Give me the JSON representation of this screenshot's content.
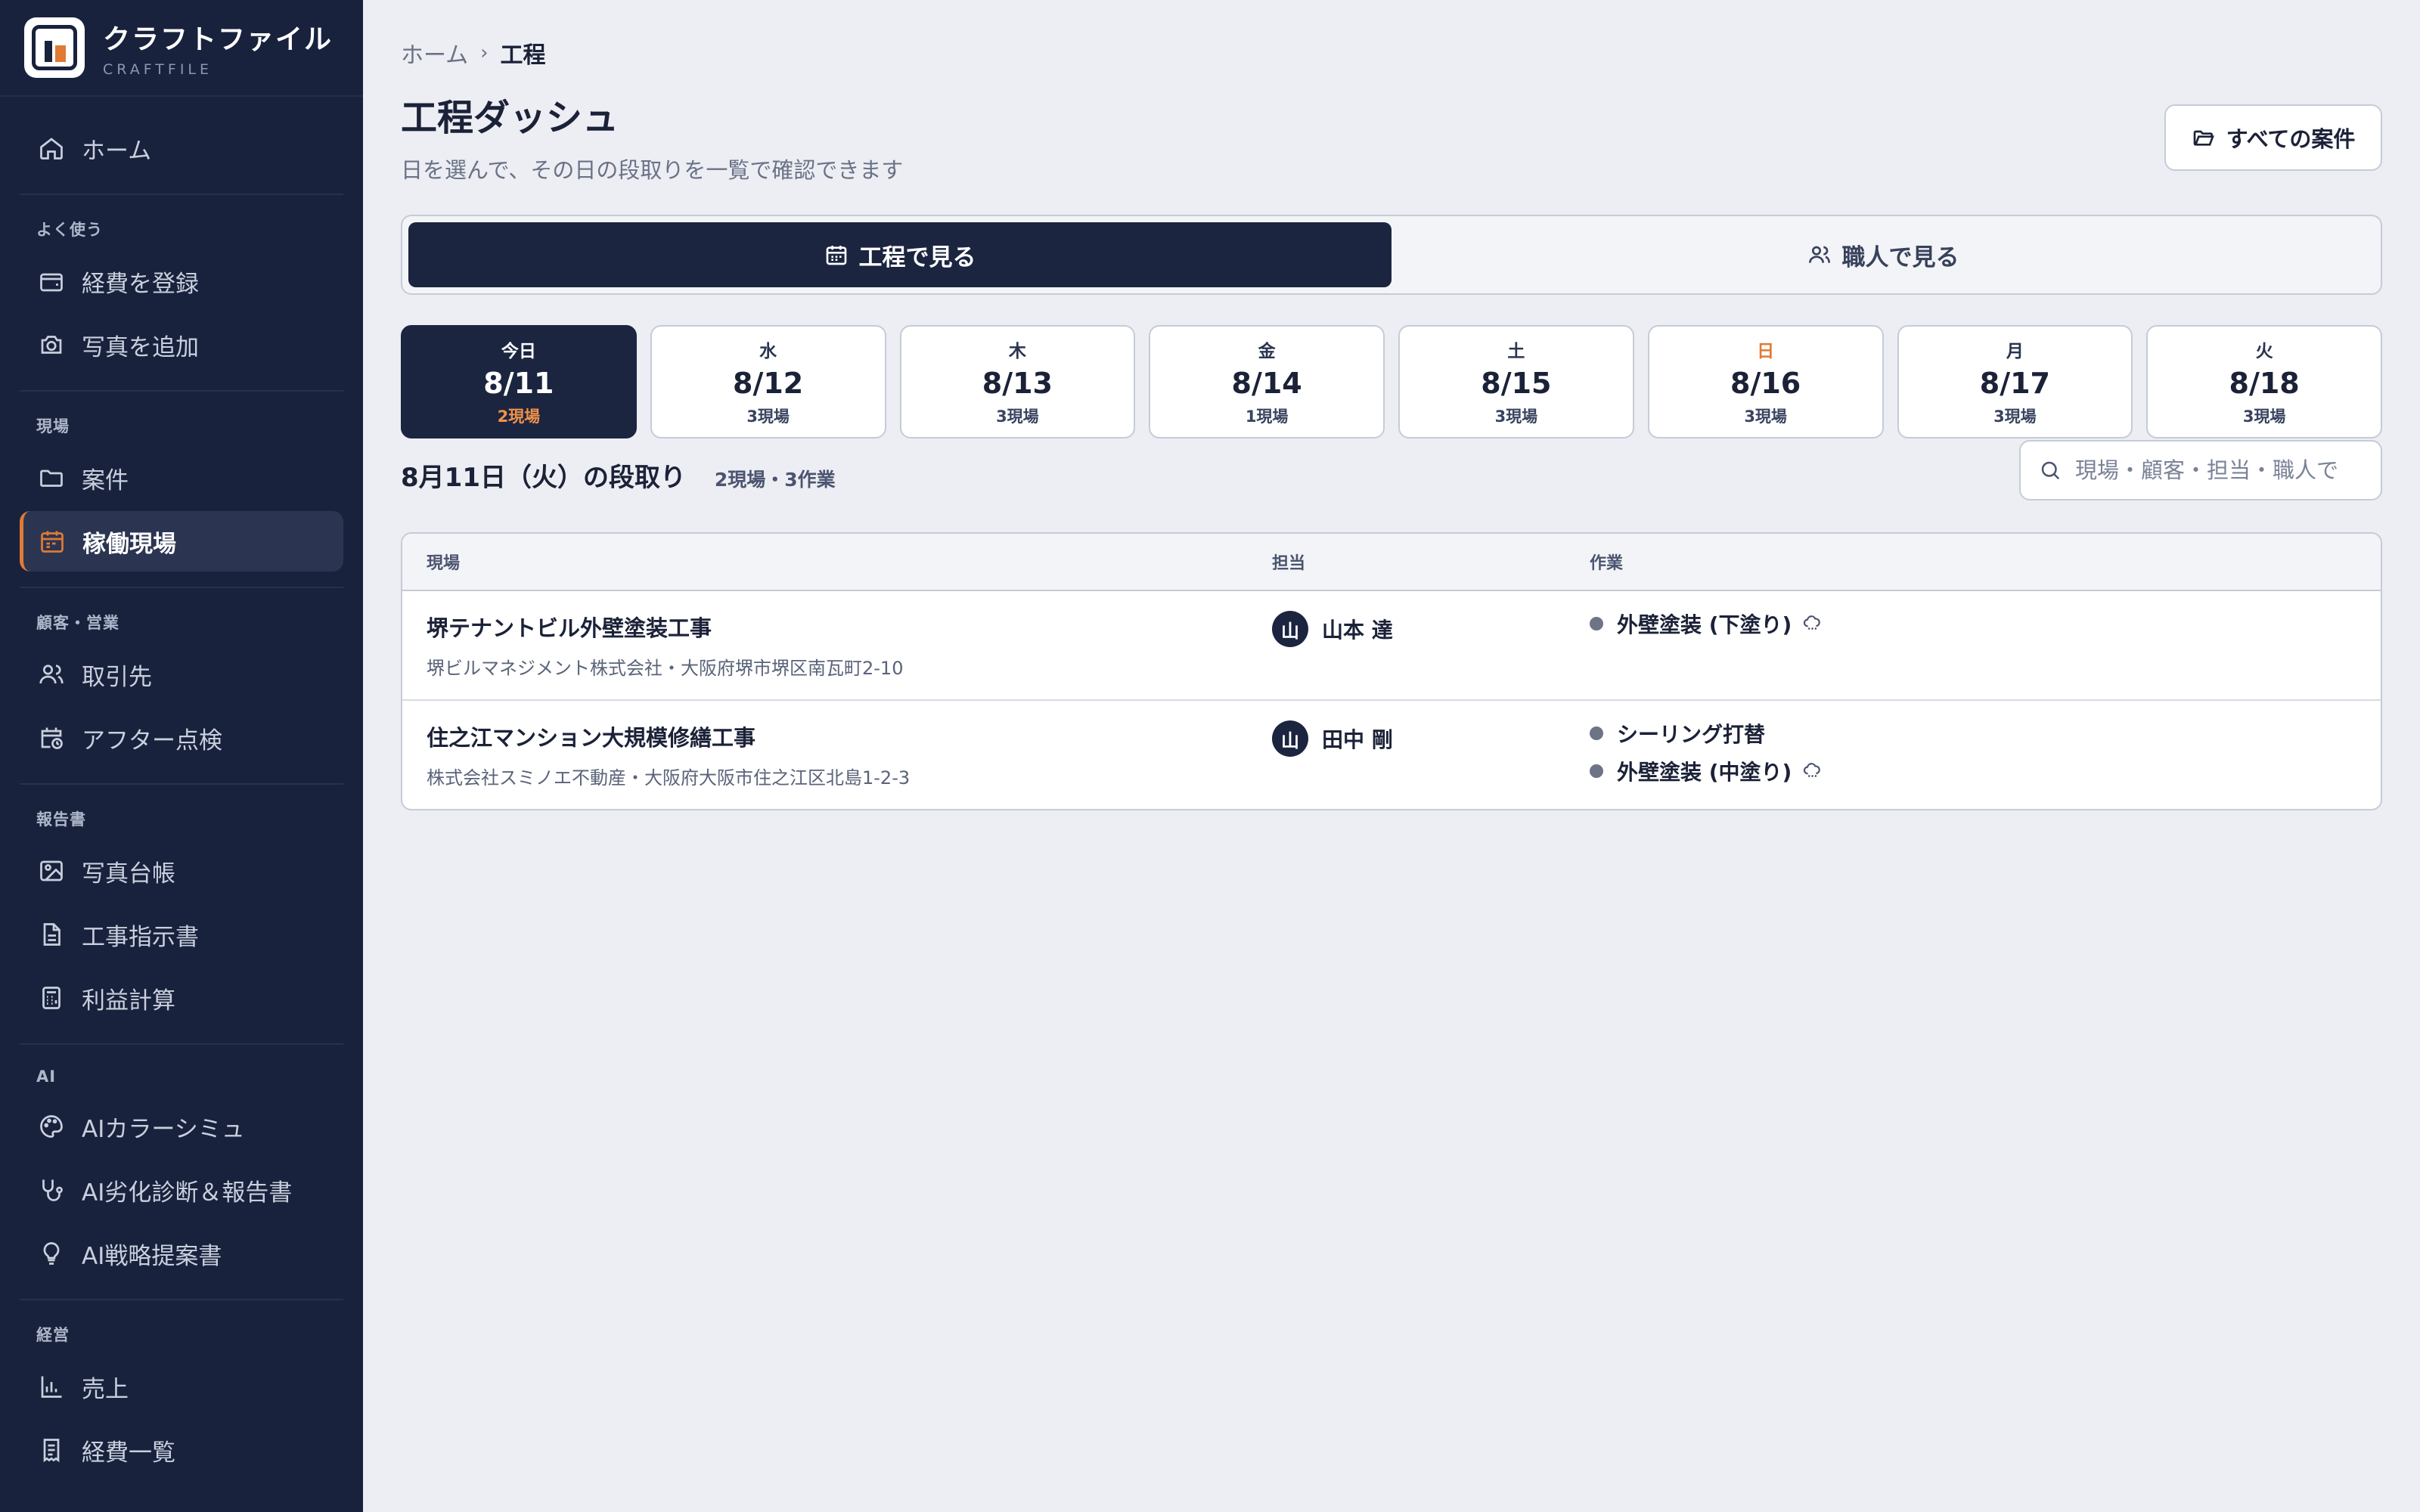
{
  "brand": {
    "name": "クラフトファイル",
    "sub": "CRAFTFILE"
  },
  "sidebar": {
    "home": "ホーム",
    "sections": {
      "frequent": "よく使う",
      "site": "現場",
      "customer": "顧客・営業",
      "report": "報告書",
      "ai": "AI",
      "management": "経営"
    },
    "items": {
      "expense_register": "経費を登録",
      "photo_add": "写真を追加",
      "projects": "案件",
      "active_sites": "稼働現場",
      "clients": "取引先",
      "after_check": "アフター点検",
      "photo_ledger": "写真台帳",
      "work_order": "工事指示書",
      "profit_calc": "利益計算",
      "ai_color": "AIカラーシミュ",
      "ai_diagnosis": "AI劣化診断＆報告書",
      "ai_strategy": "AI戦略提案書",
      "sales": "売上",
      "expense_list": "経費一覧"
    },
    "active_item": "active_sites"
  },
  "breadcrumb": {
    "home": "ホーム",
    "current": "工程"
  },
  "header": {
    "title": "工程ダッシュ",
    "subtitle": "日を選んで、その日の段取りを一覧で確認できます",
    "all_projects_label": "すべての案件"
  },
  "view_toggle": {
    "by_schedule": "工程で見る",
    "by_worker": "職人で見る",
    "selected": "by_schedule"
  },
  "days": [
    {
      "dow": "今日",
      "date": "8/11",
      "count": "2現場",
      "active": true
    },
    {
      "dow": "水",
      "date": "8/12",
      "count": "3現場"
    },
    {
      "dow": "木",
      "date": "8/13",
      "count": "3現場"
    },
    {
      "dow": "金",
      "date": "8/14",
      "count": "1現場"
    },
    {
      "dow": "土",
      "date": "8/15",
      "count": "3現場"
    },
    {
      "dow": "日",
      "date": "8/16",
      "count": "3現場",
      "sunday": true
    },
    {
      "dow": "月",
      "date": "8/17",
      "count": "3現場"
    },
    {
      "dow": "火",
      "date": "8/18",
      "count": "3現場"
    }
  ],
  "summary": {
    "title": "8月11日（火）の段取り",
    "meta": "2現場・3作業"
  },
  "search": {
    "placeholder": "現場・顧客・担当・職人で"
  },
  "table": {
    "headers": {
      "site": "現場",
      "manager": "担当",
      "tasks": "作業"
    },
    "rows": [
      {
        "site": "堺テナントビル外壁塗装工事",
        "detail": "堺ビルマネジメント株式会社・大阪府堺市堺区南瓦町2-10",
        "avatar": "山",
        "manager": "山本 達",
        "tasks": [
          {
            "name": "外壁塗装 (下塗り)",
            "weather": "cloud"
          }
        ]
      },
      {
        "site": "住之江マンション大規模修繕工事",
        "detail": "株式会社スミノエ不動産・大阪府大阪市住之江区北島1-2-3",
        "avatar": "山",
        "manager": "田中 剛",
        "tasks": [
          {
            "name": "シーリング打替"
          },
          {
            "name": "外壁塗装 (中塗り)",
            "weather": "cloud"
          }
        ]
      }
    ]
  },
  "colors": {
    "navy": "#18223d",
    "accent": "#e07a34",
    "bg": "#eceef3"
  }
}
